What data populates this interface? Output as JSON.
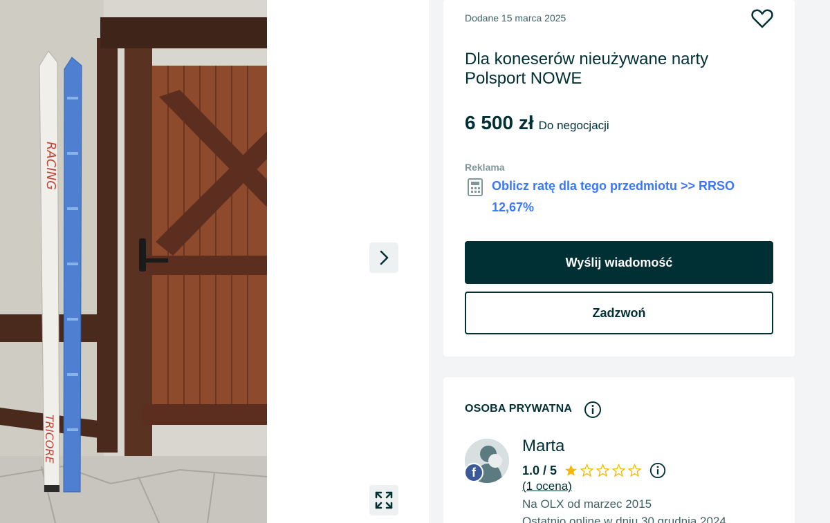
{
  "gallery": {
    "next_icon": "chevron-right-icon",
    "expand_icon": "expand-arrows-icon",
    "ski_brand_text": "RACING",
    "ski_model_text": "TRICORE"
  },
  "listing": {
    "posted": "Dodane 15 marca 2025",
    "favorite_icon": "heart-icon",
    "title": "Dla koneserów nieużywane narty Polsport NOWE",
    "price": "6 500 zł",
    "negotiable": "Do negocjacji",
    "ad_label": "Reklama",
    "calculator_icon": "calculator-icon",
    "rate_link": "Oblicz ratę dla tego przedmiotu >> RRSO 12,67%",
    "message_button": "Wyślij wiadomość",
    "call_button": "Zadzwoń"
  },
  "seller": {
    "type": "OSOBA PRYWATNA",
    "type_info_icon": "info-icon",
    "name": "Marta",
    "facebook_badge": "f",
    "rating": "1.0 / 5",
    "stars_filled": 1,
    "stars_total": 5,
    "ratings_count": "(1 ocena)",
    "member_since": "Na OLX od marzec 2015",
    "last_online": "Ostatnio online w dniu 30 grudnia 2024"
  },
  "colors": {
    "primary": "#002f34",
    "link": "#3a77ff",
    "star": "#f5b800",
    "background": "#f2f4f5"
  }
}
